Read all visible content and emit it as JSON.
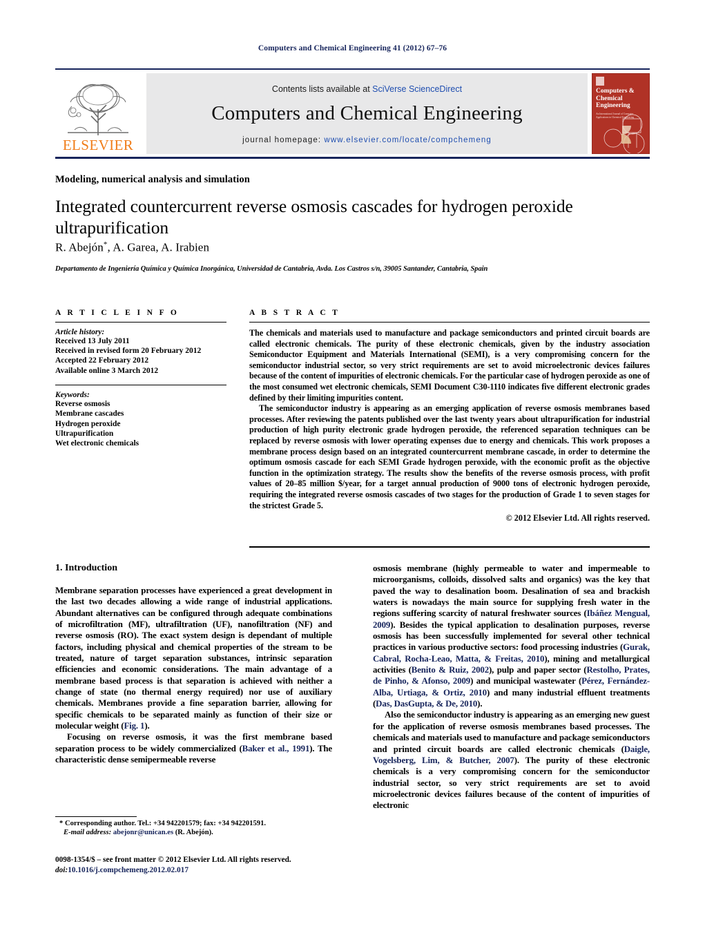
{
  "running_head": "Computers and Chemical Engineering 41 (2012) 67–76",
  "masthead": {
    "contents_prefix": "Contents lists available at ",
    "contents_link": "SciVerse ScienceDirect",
    "journal_name": "Computers and Chemical Engineering",
    "homepage_prefix": "journal homepage: ",
    "homepage_link": "www.elsevier.com/locate/compchemeng",
    "publisher_name": "ELSEVIER",
    "cover": {
      "title": "Computers & Chemical Engineering",
      "subtitle": "An International Journal of Computer Applications in Chemical Engineering"
    }
  },
  "article": {
    "section": "Modeling, numerical analysis and simulation",
    "title": "Integrated countercurrent reverse osmosis cascades for hydrogen peroxide ultrapurification",
    "authors": "R. Abejón",
    "authors_rest": ", A. Garea, A. Irabien",
    "author_mark": "*",
    "affiliation": "Departamento de Ingeniería Química y Química Inorgánica, Universidad de Cantabria, Avda. Los Castros s/n, 39005 Santander, Cantabria, Spain"
  },
  "info": {
    "heading": "A R T I C L E   I N F O",
    "history_label": "Article history:",
    "history": [
      "Received 13 July 2011",
      "Received in revised form 20 February 2012",
      "Accepted 22 February 2012",
      "Available online 3 March 2012"
    ],
    "keywords_label": "Keywords:",
    "keywords": [
      "Reverse osmosis",
      "Membrane cascades",
      "Hydrogen peroxide",
      "Ultrapurification",
      "Wet electronic chemicals"
    ]
  },
  "abstract": {
    "heading": "A B S T R A C T",
    "paragraph_1": "The chemicals and materials used to manufacture and package semiconductors and printed circuit boards are called electronic chemicals. The purity of these electronic chemicals, given by the industry association Semiconductor Equipment and Materials International (SEMI), is a very compromising concern for the semiconductor industrial sector, so very strict requirements are set to avoid microelectronic devices failures because of the content of impurities of electronic chemicals. For the particular case of hydrogen peroxide as one of the most consumed wet electronic chemicals, SEMI Document C30-1110 indicates five different electronic grades defined by their limiting impurities content.",
    "paragraph_2": "The semiconductor industry is appearing as an emerging application of reverse osmosis membranes based processes. After reviewing the patents published over the last twenty years about ultrapurification for industrial production of high purity electronic grade hydrogen peroxide, the referenced separation techniques can be replaced by reverse osmosis with lower operating expenses due to energy and chemicals. This work proposes a membrane process design based on an integrated countercurrent membrane cascade, in order to determine the optimum osmosis cascade for each SEMI Grade hydrogen peroxide, with the economic profit as the objective function in the optimization strategy. The results show the benefits of the reverse osmosis process, with profit values of 20–85 million $/year, for a target annual production of 9000 tons of electronic hydrogen peroxide, requiring the integrated reverse osmosis cascades of two stages for the production of Grade 1 to seven stages for the strictest Grade 5.",
    "copyright": "© 2012 Elsevier Ltd. All rights reserved."
  },
  "introduction": {
    "heading": "1.  Introduction",
    "left_p1": "Membrane separation processes have experienced a great development in the last two decades allowing a wide range of industrial applications. Abundant alternatives can be configured through adequate combinations of microfiltration (MF), ultrafiltration (UF), nanofiltration (NF) and reverse osmosis (RO). The exact system design is dependant of multiple factors, including physical and chemical properties of the stream to be treated, nature of target separation substances, intrinsic separation efficiencies and economic considerations. The main advantage of a membrane based process is that separation is achieved with neither a change of state (no thermal energy required) nor use of auxiliary chemicals. Membranes provide a fine separation barrier, allowing for specific chemicals to be separated mainly as function of their size or molecular weight (",
    "left_p1_cite": "Fig. 1",
    "left_p1_end": ").",
    "left_p2_a": "Focusing on reverse osmosis, it was the first membrane based separation process to be widely commercialized (",
    "left_p2_cite": "Baker et al., 1991",
    "left_p2_b": "). The characteristic dense semipermeable reverse",
    "right_p1_a": "osmosis membrane (highly permeable to water and impermeable to microorganisms, colloids, dissolved salts and organics) was the key that paved the way to desalination boom. Desalination of sea and brackish waters is nowadays the main source for supplying fresh water in the regions suffering scarcity of natural freshwater sources (",
    "right_p1_cite1": "Ibáñez Mengual, 2009",
    "right_p1_b": "). Besides the typical application to desalination purposes, reverse osmosis has been successfully implemented for several other technical practices in various productive sectors: food processing industries (",
    "right_p1_cite2": "Gurak, Cabral, Rocha-Leao, Matta, & Freitas, 2010",
    "right_p1_c": "), mining and metallurgical activities (",
    "right_p1_cite3": "Benito & Ruiz, 2002",
    "right_p1_d": "), pulp and paper sector (",
    "right_p1_cite4": "Restolho, Prates, de Pinho, & Afonso, 2009",
    "right_p1_e": ") and municipal wastewater (",
    "right_p1_cite5": "Pérez, Fernández-Alba, Urtiaga, & Ortiz, 2010",
    "right_p1_f": ") and many industrial effluent treatments (",
    "right_p1_cite6": "Das, DasGupta, & De, 2010",
    "right_p1_g": ").",
    "right_p2_a": "Also the semiconductor industry is appearing as an emerging new guest for the application of reverse osmosis membranes based processes. The chemicals and materials used to manufacture and package semiconductors and printed circuit boards are called electronic chemicals (",
    "right_p2_cite1": "Daigle, Vogelsberg, Lim, & Butcher, 2007",
    "right_p2_b": "). The purity of these electronic chemicals is a very compromising concern for the semiconductor industrial sector, so very strict requirements are set to avoid microelectronic devices failures because of the content of impurities of electronic"
  },
  "footer": {
    "corresponding": "* Corresponding author. Tel.: +34 942201579; fax: +34 942201591.",
    "email_label": "E-mail address:",
    "email": "abejonr@unican.es",
    "email_suffix": "(R. Abejón).",
    "issn_line": "0098-1354/$ – see front matter © 2012 Elsevier Ltd. All rights reserved.",
    "doi_label": "doi:",
    "doi": "10.1016/j.compchemeng.2012.02.017"
  }
}
